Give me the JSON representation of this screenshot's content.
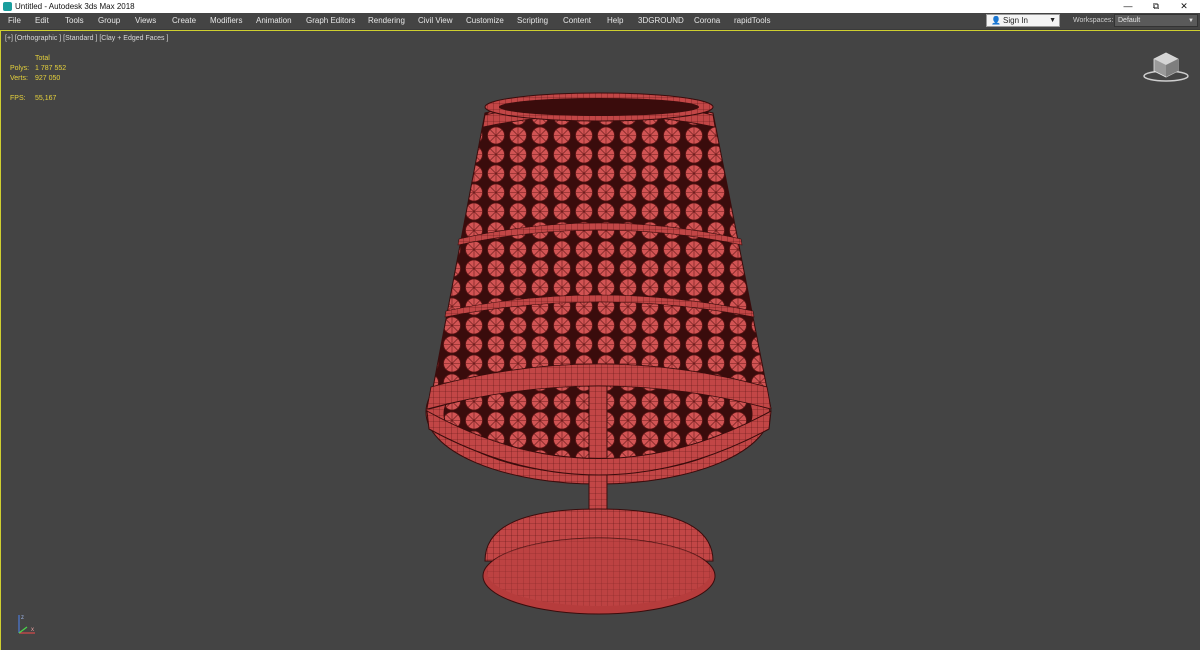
{
  "window": {
    "title": "Untitled - Autodesk 3ds Max 2018",
    "minimize": "—",
    "maximize": "⧉",
    "close": "✕"
  },
  "menu": {
    "items": [
      "File",
      "Edit",
      "Tools",
      "Group",
      "Views",
      "Create",
      "Modifiers",
      "Animation",
      "Graph Editors",
      "Rendering",
      "Civil View",
      "Customize",
      "Scripting",
      "Content",
      "Help",
      "3DGROUND",
      "Corona",
      "rapidTools"
    ]
  },
  "signin": {
    "label": "Sign In"
  },
  "workspaces": {
    "label": "Workspaces:",
    "value": "Default"
  },
  "viewport": {
    "label": "[+] [Orthographic ] [Standard ] [Clay + Edged Faces ]",
    "stats": {
      "header": "Total",
      "polys_label": "Polys:",
      "polys_value": "1 787 552",
      "verts_label": "Verts:",
      "verts_value": "927 050",
      "fps_label": "FPS:",
      "fps_value": "55,167"
    }
  },
  "colors": {
    "viewport_bg": "#444444",
    "model_fill": "#c84a4a",
    "model_wire": "#5a1414",
    "stats_text": "#e6d23c",
    "active_border": "#cfcf30"
  },
  "icons": {
    "app": "3ds-max-icon",
    "viewcube": "viewcube-icon",
    "axis": "axis-tripod-icon",
    "user": "user-icon"
  }
}
